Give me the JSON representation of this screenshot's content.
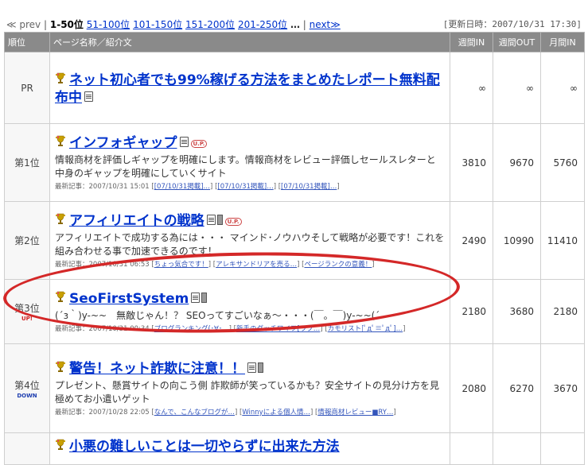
{
  "pager": {
    "prev": "≪ prev",
    "sep": "|",
    "current": "1-50位",
    "pages": [
      "51-100位",
      "101-150位",
      "151-200位",
      "201-250位"
    ],
    "ellipsis": "…",
    "next": "next≫"
  },
  "updated": "[更新日時：2007/10/31 17:30]",
  "columns": {
    "rank": "順位",
    "name": "ページ名称／紹介文",
    "week_in": "週間IN",
    "week_out": "週間OUT",
    "month_in": "月間IN"
  },
  "rows": [
    {
      "rank": "PR",
      "title": "ネット初心者でも99%稼げる方法をまとめたレポート無料配布中",
      "desc": "",
      "recent_label": "",
      "recent": [],
      "week_in": "∞",
      "week_out": "∞",
      "month_in": "∞"
    },
    {
      "rank": "第1位",
      "title": "インフォギャップ",
      "badge": "U.P.",
      "desc": "情報商材を評価しギャップを明確にします。情報商材をレビュー評価しセールスレターと中身のギャップを明確にしていくサイト",
      "recent_label": "最新記事：2007/10/31 15:01",
      "recent": [
        "[07/10/31掲載]…",
        "[07/10/31掲載]…",
        "[07/10/31掲載]…"
      ],
      "week_in": "3810",
      "week_out": "9670",
      "month_in": "5760"
    },
    {
      "rank": "第2位",
      "title": "アフィリエイトの戦略",
      "badge": "U.P.",
      "desc": "アフィリエイトで成功する為には・・・ マインド･ノウハウそして戦略が必要です！これを組み合わせる事で加速できるのです！",
      "recent_label": "最新記事：2007/10/31 06:53",
      "recent": [
        "ちょっ気合です！",
        "アレキサンドリアを売る…",
        "ページランクの意義！"
      ],
      "week_in": "2490",
      "week_out": "10990",
      "month_in": "11410"
    },
    {
      "rank": "第3位",
      "rank_mark": "UP!",
      "title": "SeoFirstSystem",
      "desc": "(´з｀)y-~~　無敵じゃん！？ SEOってすごいなぁ～・・・(￣。￣)y-~~(´",
      "recent_label": "最新記事：2007/10/31 00:34",
      "recent": [
        "ブログランキング(･∀･…",
        "新手のダッチワイフ[ラブ…",
        "カモリスト[ﾟдﾟ≡ﾟдﾟ]…"
      ],
      "week_in": "2180",
      "week_out": "3680",
      "month_in": "2180"
    },
    {
      "rank": "第4位",
      "rank_mark": "DOWN",
      "title": "警告！ネット詐欺に注意！！",
      "desc": "プレゼント、懸賞サイトの向こう側 詐欺師が笑っているかも？安全サイトの見分け方を見極めてお小遣いゲット",
      "recent_label": "最新記事：2007/10/28 22:05",
      "recent": [
        "なんで、こんなブログが…",
        "Winnyによる個人情…",
        "情報商材レビュー■RY…"
      ],
      "week_in": "2080",
      "week_out": "6270",
      "month_in": "3670"
    },
    {
      "rank": "",
      "title": "小悪の難しいことは一切やらずに出来た方法",
      "desc": "",
      "recent_label": "",
      "recent": [],
      "week_in": "",
      "week_out": "",
      "month_in": ""
    }
  ]
}
